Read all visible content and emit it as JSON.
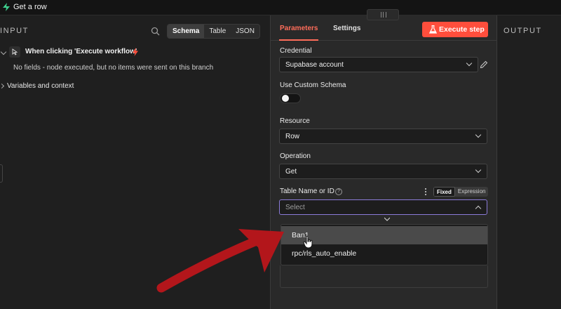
{
  "node_title": "Get a row",
  "input": {
    "title": "INPUT",
    "views": [
      "Schema",
      "Table",
      "JSON"
    ],
    "trigger_label": "When clicking 'Execute workflow'",
    "no_fields_text": "No fields - node executed, but no items were sent on this branch",
    "variables_label": "Variables and context"
  },
  "parameters": {
    "tabs": [
      "Parameters",
      "Settings"
    ],
    "execute_label": "Execute step",
    "credential_label": "Credential",
    "credential_value": "Supabase account",
    "custom_schema_label": "Use Custom Schema",
    "custom_schema_on": false,
    "resource_label": "Resource",
    "resource_value": "Row",
    "operation_label": "Operation",
    "operation_value": "Get",
    "table_label": "Table Name or ID",
    "table_mode": [
      "Fixed",
      "Expression"
    ],
    "table_placeholder": "Select",
    "options": [
      "Ban1",
      "rpc/rls_auto_enable"
    ]
  },
  "output": {
    "title": "OUTPUT"
  },
  "colors": {
    "accent": "#ff6d5a",
    "execute": "#ff4e3c",
    "annotation_arrow": "#b3161b"
  }
}
